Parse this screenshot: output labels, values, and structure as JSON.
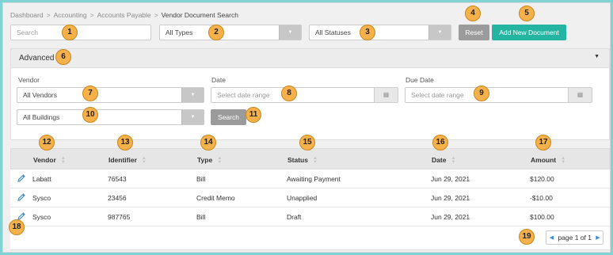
{
  "breadcrumb": [
    "Dashboard",
    "Accounting",
    "Accounts Payable",
    "Vendor Document Search"
  ],
  "search": {
    "placeholder": "Search"
  },
  "filters": {
    "types_value": "All Types",
    "statuses_value": "All Statuses",
    "reset_label": "Reset",
    "add_label": "Add New Document"
  },
  "advanced": {
    "title": "Advanced",
    "vendor_label": "Vendor",
    "vendor_value": "All Vendors",
    "building_value": "All Buildings",
    "date_label": "Date",
    "date_placeholder": "Select date range",
    "due_label": "Due Date",
    "due_placeholder": "Select date range",
    "search_label": "Search"
  },
  "table": {
    "columns": [
      "Vendor",
      "Identifier",
      "Type",
      "Status",
      "Date",
      "Amount"
    ],
    "rows": [
      [
        "Labatt",
        "76543",
        "Bill",
        "Awaiting Payment",
        "Jun 29, 2021",
        "$120.00"
      ],
      [
        "Sysco",
        "23456",
        "Credit Memo",
        "Unapplied",
        "Jun 29, 2021",
        "-$10.00"
      ],
      [
        "Sysco",
        "987765",
        "Bill",
        "Draft",
        "Jun 29, 2021",
        "$100.00"
      ]
    ]
  },
  "pagination": {
    "text": "page 1 of 1"
  },
  "badges": [
    "1",
    "2",
    "3",
    "4",
    "5",
    "6",
    "7",
    "8",
    "9",
    "10",
    "11",
    "12",
    "13",
    "14",
    "15",
    "16",
    "17",
    "18",
    "19"
  ],
  "colors": {
    "accent": "#23b5a1",
    "badge": "#f7b14a",
    "border": "#7fd3d5",
    "edit_icon": "#3a8fd8"
  },
  "icons": {
    "edit": "pencil-icon",
    "calendar": "calendar-icon",
    "sort": "sort-icon",
    "prev": "chevron-left-icon",
    "next": "chevron-right-icon",
    "collapse": "caret-down-icon"
  }
}
